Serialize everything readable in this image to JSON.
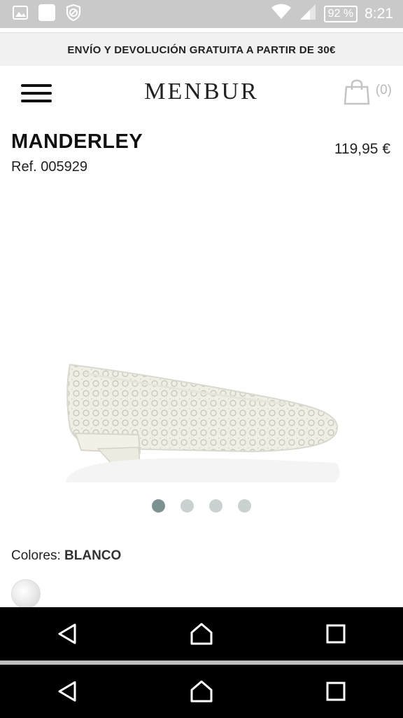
{
  "status_bar": {
    "battery": "92 %",
    "time": "8:21",
    "icons": [
      "image-icon",
      "app-icon",
      "shield-icon",
      "wifi-icon",
      "signal-icon",
      "battery-icon"
    ]
  },
  "promo_banner": "ENVÍO Y DEVOLUCIÓN GRATUITA A PARTIR DE 30€",
  "header": {
    "brand": "MENBUR",
    "cart_count": "(0)"
  },
  "product": {
    "name": "MANDERLEY",
    "ref": "Ref. 005929",
    "price": "119,95 €",
    "gallery_dots": 4,
    "active_dot": 1
  },
  "colors": {
    "label": "Colores:",
    "value": "BLANCO"
  },
  "nav_buttons": [
    "back",
    "home",
    "recents"
  ]
}
